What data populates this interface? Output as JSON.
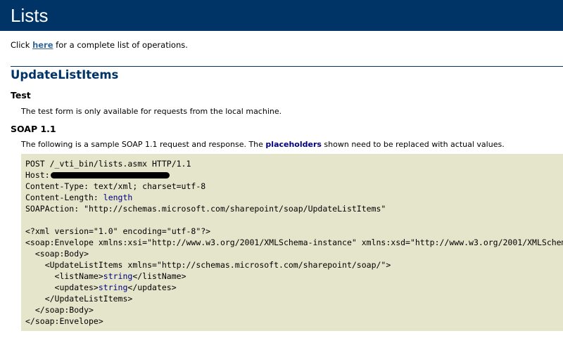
{
  "header": {
    "title": "Lists"
  },
  "intro": {
    "prefix": "Click ",
    "link": "here",
    "suffix": " for a complete list of operations."
  },
  "operation": {
    "title": "UpdateListItems"
  },
  "test": {
    "heading": "Test",
    "text": "The test form is only available for requests from the local machine."
  },
  "soap": {
    "heading": "SOAP 1.1",
    "text_prefix": "The following is a sample SOAP 1.1 request and response. The ",
    "placeholders": "placeholders",
    "text_suffix": " shown need to be replaced with actual values.",
    "request": {
      "line1": "POST /_vti_bin/lists.asmx HTTP/1.1",
      "host_label": "Host:",
      "content_type": "Content-Type: text/xml; charset=utf-8",
      "content_length_label": "Content-Length: ",
      "content_length_value": "length",
      "soap_action": "SOAPAction: \"http://schemas.microsoft.com/sharepoint/soap/UpdateListItems\"",
      "xml_decl": "<?xml version=\"1.0\" encoding=\"utf-8\"?>",
      "envelope_open": "<soap:Envelope xmlns:xsi=\"http://www.w3.org/2001/XMLSchema-instance\" xmlns:xsd=\"http://www.w3.org/2001/XMLSchema\" xmlns:soap=\"http://schemas.xmlsoap.org/soap/envelope/\">",
      "body_open": "  <soap:Body>",
      "op_open": "    <UpdateListItems xmlns=\"http://schemas.microsoft.com/sharepoint/soap/\">",
      "listname_open": "      <listName>",
      "listname_value": "string",
      "listname_close": "</listName>",
      "updates_open": "      <updates>",
      "updates_value": "string",
      "updates_close": "</updates>",
      "op_close": "    </UpdateListItems>",
      "body_close": "  </soap:Body>",
      "envelope_close": "</soap:Envelope>"
    }
  },
  "colors": {
    "header_bg": "#003366",
    "link": "#336699",
    "placeholder": "#000080",
    "code_bg": "#e5e5cc"
  }
}
